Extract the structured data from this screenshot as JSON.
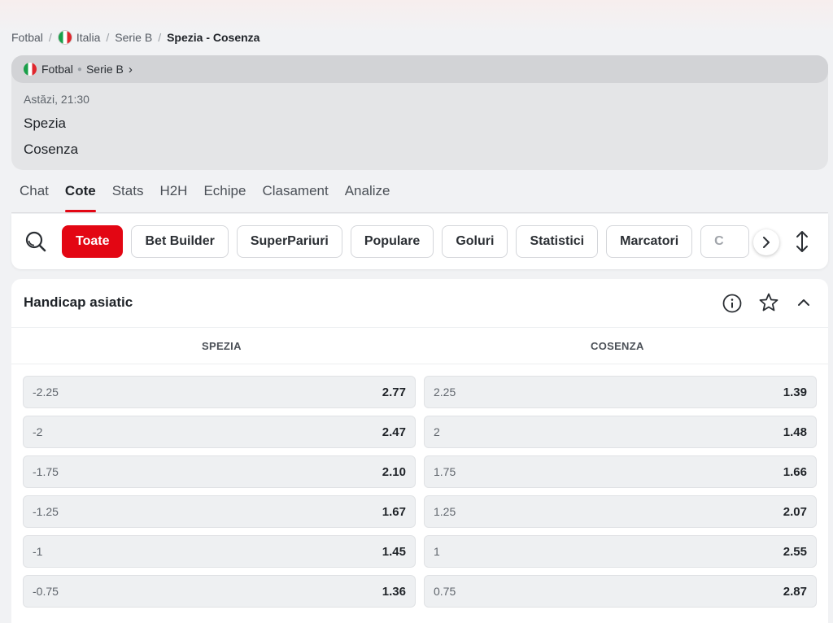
{
  "breadcrumb": {
    "items": [
      "Fotbal",
      "Italia",
      "Serie B"
    ],
    "current": "Spezia - Cosenza"
  },
  "match": {
    "sport": "Fotbal",
    "league": "Serie B",
    "time": "Astăzi, 21:30",
    "home": "Spezia",
    "away": "Cosenza"
  },
  "tabs": [
    "Chat",
    "Cote",
    "Stats",
    "H2H",
    "Echipe",
    "Clasament",
    "Analize"
  ],
  "active_tab": "Cote",
  "filters": [
    "Toate",
    "Bet Builder",
    "SuperPariuri",
    "Populare",
    "Goluri",
    "Statistici",
    "Marcatori",
    "C"
  ],
  "active_filter": "Toate",
  "market": {
    "title": "Handicap asiatic",
    "home_header": "SPEZIA",
    "away_header": "COSENZA",
    "rows": [
      {
        "home_line": "-2.25",
        "home_odd": "2.77",
        "away_line": "2.25",
        "away_odd": "1.39"
      },
      {
        "home_line": "-2",
        "home_odd": "2.47",
        "away_line": "2",
        "away_odd": "1.48"
      },
      {
        "home_line": "-1.75",
        "home_odd": "2.10",
        "away_line": "1.75",
        "away_odd": "1.66"
      },
      {
        "home_line": "-1.25",
        "home_odd": "1.67",
        "away_line": "1.25",
        "away_odd": "2.07"
      },
      {
        "home_line": "-1",
        "home_odd": "1.45",
        "away_line": "1",
        "away_odd": "2.55"
      },
      {
        "home_line": "-0.75",
        "home_odd": "1.36",
        "away_line": "0.75",
        "away_odd": "2.87"
      }
    ]
  },
  "colors": {
    "accent": "#e30613",
    "card": "#e4e5e7"
  }
}
